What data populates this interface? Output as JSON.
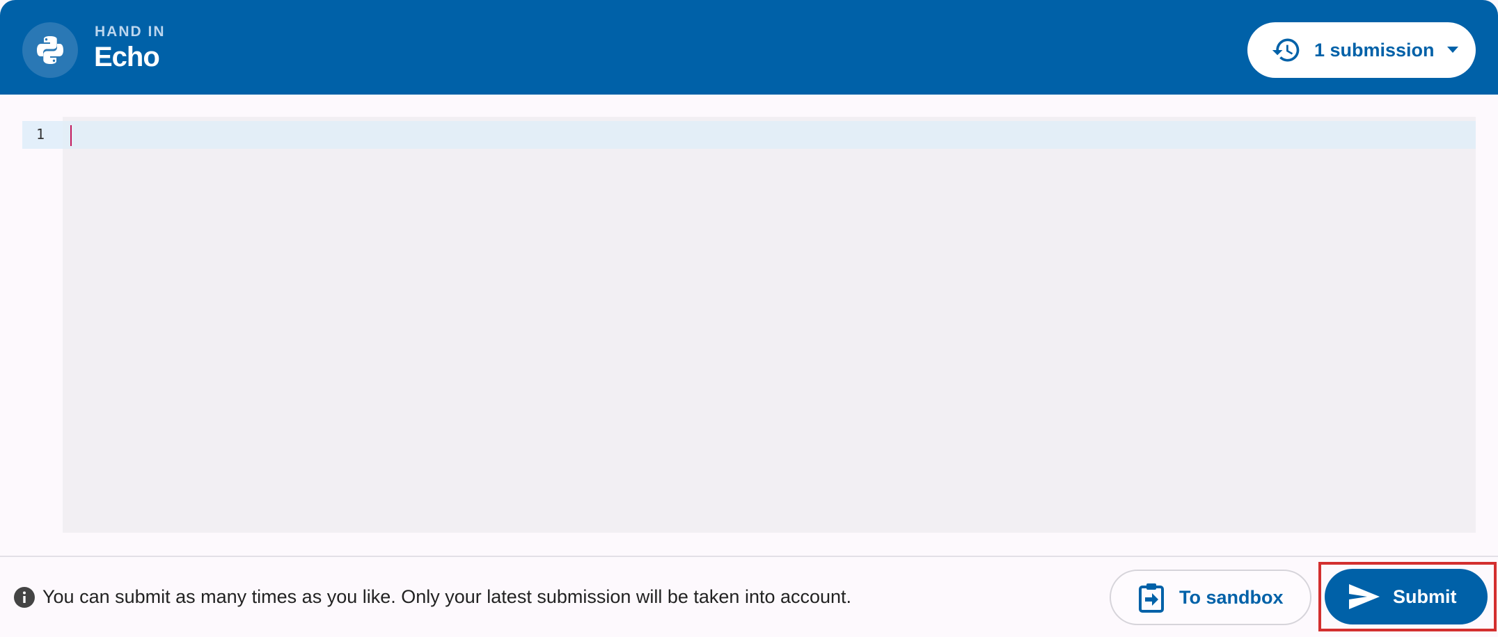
{
  "header": {
    "eyebrow": "HAND IN",
    "title": "Echo",
    "logo_icon": "python-logo-icon",
    "submissions_label": "1 submission",
    "history_icon": "history-icon",
    "dropdown_icon": "caret-down-icon"
  },
  "editor": {
    "line_numbers": [
      "1"
    ],
    "code": ""
  },
  "footer": {
    "info_icon": "info-icon",
    "info_text": "You can submit as many times as you like. Only your latest submission will be taken into account.",
    "sandbox_label": "To sandbox",
    "sandbox_icon": "clipboard-arrow-icon",
    "submit_label": "Submit",
    "submit_icon": "send-icon"
  },
  "colors": {
    "primary": "#0061a8",
    "header_bg": "#0061a8",
    "editor_bg": "#f2eff3",
    "active_line": "#e3eef7",
    "cursor": "#c2185b",
    "highlight_border": "#d32f2f"
  }
}
